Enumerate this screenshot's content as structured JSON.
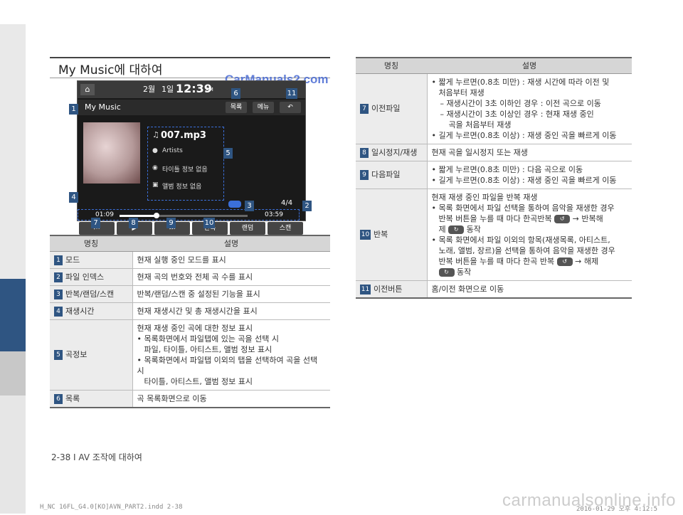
{
  "section_title": "My Music에 대하여",
  "watermark": "CarManuals2.com",
  "screen": {
    "home_icon": "home-icon",
    "month": "2월",
    "day": "1일",
    "time": "12:39",
    "ampm": "AM",
    "title": "My Music",
    "list_btn": "목록",
    "menu_btn": "메뉴",
    "back_icon": "back-arrow-icon",
    "song": "007.mp3",
    "artist": "Artists",
    "title_info": "타이틀 정보 없음",
    "album_info": "앨범 정보 없음",
    "index": "4/4",
    "elapsed": "01:09",
    "total": "03:59",
    "progress": 0.29,
    "prev_icon": "skip-previous-icon",
    "play_icon": "play-icon",
    "next_icon": "skip-next-icon",
    "repeat_btn": "반복",
    "random_btn": "랜덤",
    "scan_btn": "스캔"
  },
  "badges": {
    "b1": "1",
    "b2": "2",
    "b3": "3",
    "b4": "4",
    "b5": "5",
    "b6": "6",
    "b7": "7",
    "b8": "8",
    "b9": "9",
    "b10": "10",
    "b11": "11"
  },
  "table_left": {
    "head_name": "명칭",
    "head_desc": "설명",
    "rows": [
      {
        "num": "1",
        "name": "모드",
        "desc": "현재 실행 중인 모드를 표시"
      },
      {
        "num": "2",
        "name": "파일 인덱스",
        "desc": "현재 곡의 번호와 전체 곡 수를 표시"
      },
      {
        "num": "3",
        "name": "반복/랜덤/스캔",
        "desc": "반복/랜덤/스캔 중 설정된 기능을 표시"
      },
      {
        "num": "4",
        "name": "재생시간",
        "desc": "현재 재생시간 및 총 재생시간을 표시"
      },
      {
        "num": "5",
        "name": "곡정보",
        "desc1": "현재 재생 중인 곡에 대한 정보 표시",
        "desc2": "목록화면에서 파일탭에 있는 곡을 선택 시",
        "desc3": "파일, 타이틀, 아티스트, 앨범 정보 표시",
        "desc4": "목록화면에서 파일탭 이외의 탭을 선택하여 곡을 선택 시",
        "desc5": "타이틀, 아티스트, 앨범 정보 표시"
      },
      {
        "num": "6",
        "name": "목록",
        "desc": "곡 목록화면으로 이동"
      }
    ]
  },
  "table_right": {
    "head_name": "명칭",
    "head_desc": "설명",
    "r7": {
      "num": "7",
      "name": "이전파일",
      "l1": "짧게 누르면(0.8초 미만) : 재생 시간에 따라 이전 및",
      "l2": "처음부터 재생",
      "l3": "재생시간이 3초 이하인 경우 : 이전 곡으로 이동",
      "l4": "재생시간이 3초 이상인 경우 : 현재 재생 중인",
      "l5": "곡을 처음부터 재생",
      "l6": "길게 누르면(0.8초 이상) : 재생 중인 곡을 빠르게 이동"
    },
    "r8": {
      "num": "8",
      "name": "일시정지/재생",
      "desc": "현재 곡을 일시정지 또는 재생"
    },
    "r9": {
      "num": "9",
      "name": "다음파일",
      "l1": "짧게 누르면(0.8초 미만) : 다음 곡으로 이동",
      "l2": "길게 누르면(0.8초 이상) : 재생 중인 곡을 빠르게 이동"
    },
    "r10": {
      "num": "10",
      "name": "반복",
      "l1": "현재 재생 중인 파일을 반복 재생",
      "l2": "목록 화면에서 파일 선택을 통하여 음악을 재생한 경우",
      "l3a": "반복 버튼을 누를 때 마다 한곡반복",
      "l3b": "→ 반복해",
      "l4": "제",
      "l4b": "동작",
      "l5": "목록 화면에서 파일 이외의 항목(재생목록, 아티스트,",
      "l6": "노래, 앨범, 장르)을 선택을 통하여 음악을 재생한 경우",
      "l7a": "반복 버튼을 누를 때 마다 한곡 반복",
      "l7b": "→ 해제",
      "l8": "동작"
    },
    "r11": {
      "num": "11",
      "name": "이전버튼",
      "desc": "홈/이전 화면으로 이동"
    }
  },
  "footer": {
    "page": "2-38 I AV 조작에 대하여",
    "file": "H_NC 16FL_G4.0[KO]AVN_PART2.indd   2-38",
    "date": "2016-01-29   오후 4:12:5",
    "site": "carmanualsonline.info"
  }
}
